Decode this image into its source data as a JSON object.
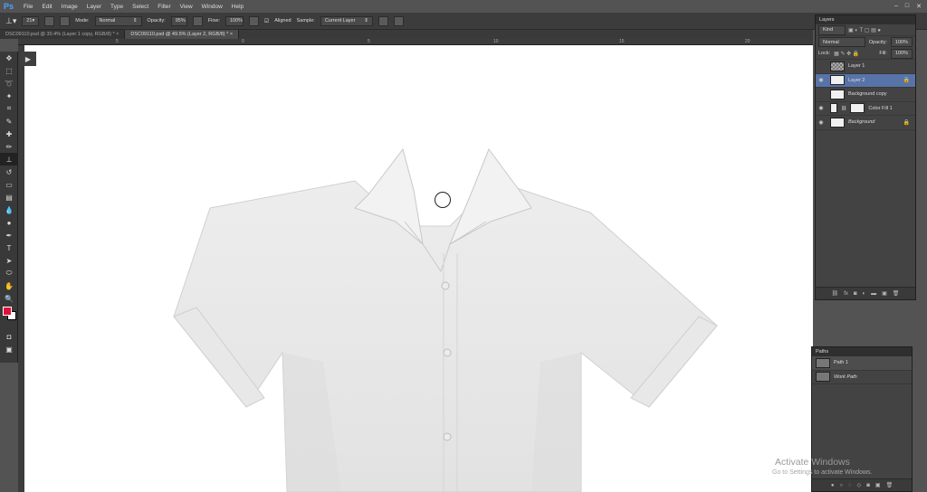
{
  "menu": {
    "logo": "Ps",
    "items": [
      "File",
      "Edit",
      "Image",
      "Layer",
      "Type",
      "Select",
      "Filter",
      "View",
      "Window",
      "Help"
    ]
  },
  "options": {
    "mode_label": "Mode:",
    "mode_value": "Normal",
    "opacity_label": "Opacity:",
    "opacity_value": "95%",
    "flow_label": "Flow:",
    "flow_value": "100%",
    "aligned_label": "Aligned",
    "sample_label": "Sample:",
    "sample_value": "Current Layer"
  },
  "tabs": [
    {
      "label": "DSC09110.psd @ 30.4% (Layer 1 copy, RGB/8) *"
    },
    {
      "label": "DSC09110.psd @ 49.5% (Layer 2, RGB/8) *"
    }
  ],
  "ruler_top": [
    "5",
    "0",
    "5",
    "10",
    "15",
    "20",
    "25"
  ],
  "layers_panel": {
    "title": "Layers",
    "kind_label": "Kind",
    "blend_value": "Normal",
    "opacity_label": "Opacity:",
    "opacity_value": "100%",
    "lock_label": "Lock:",
    "fill_label": "Fill:",
    "fill_value": "100%",
    "layers": [
      {
        "name": "Layer 1"
      },
      {
        "name": "Layer 2"
      },
      {
        "name": "Background copy"
      },
      {
        "name": "Color Fill 1"
      },
      {
        "name": "Background"
      }
    ]
  },
  "paths_panel": {
    "title": "Paths",
    "paths": [
      {
        "name": "Path 1"
      },
      {
        "name": "Work Path"
      }
    ]
  },
  "watermark": {
    "title": "Activate Windows",
    "subtitle": "Go to Settings to activate Windows."
  },
  "colors": {
    "foreground": "#e0103a",
    "background": "#ffffff",
    "selection": "#5873a8"
  }
}
